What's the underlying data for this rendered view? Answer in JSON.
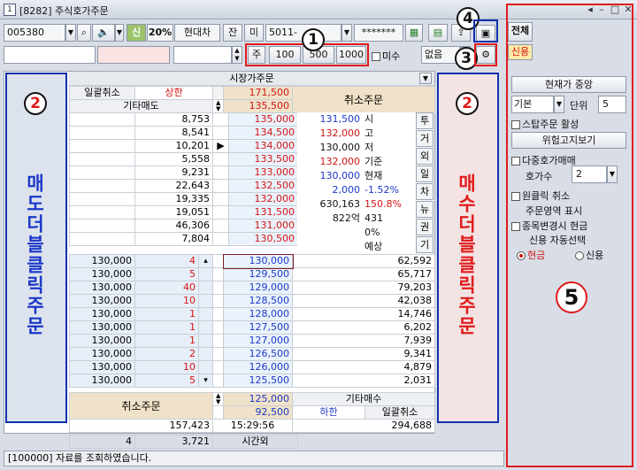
{
  "window": {
    "icon": "1",
    "title": "[8282] 주식호가주문"
  },
  "toolbar": {
    "code": "005380",
    "sin": "신",
    "pct": "20%",
    "stock_name": "현대차",
    "jan": "잔",
    "mi": "미",
    "account": "5011-",
    "password": "*******",
    "btn_all": "전체",
    "btn_credit": "신용"
  },
  "qtybar": {
    "ju": "주",
    "q1": "100",
    "q2": "500",
    "q3": "1000",
    "misu": "미수",
    "none": "없음"
  },
  "header": {
    "market_order": "시장가주문",
    "cancel_all": "일괄취소",
    "upper": "상한",
    "upper_price": "171,500",
    "etc_sell": "기타매도",
    "etc_sell_price": "135,500",
    "cancel_order": "취소주문"
  },
  "ask_rows": [
    {
      "qty": "8,753",
      "price": "135,000"
    },
    {
      "qty": "8,541",
      "price": "134,500"
    },
    {
      "qty": "10,201",
      "price": "134,000"
    },
    {
      "qty": "5,558",
      "price": "133,500"
    },
    {
      "qty": "9,231",
      "price": "133,000"
    },
    {
      "qty": "22,643",
      "price": "132,500"
    },
    {
      "qty": "19,335",
      "price": "132,000"
    },
    {
      "qty": "19,051",
      "price": "131,500"
    },
    {
      "qty": "46,306",
      "price": "131,000"
    },
    {
      "qty": "7,804",
      "price": "130,500"
    }
  ],
  "info_rows": [
    {
      "val": "131,500",
      "label": "시"
    },
    {
      "val": "132,000",
      "label": "고"
    },
    {
      "val": "130,000",
      "label": "저"
    },
    {
      "val": "132,000",
      "label": "기준"
    },
    {
      "val": "130,000",
      "label": "현재"
    },
    {
      "val": "2,000",
      "label": "-1.52%"
    },
    {
      "val": "630,163",
      "label": "150.8%"
    },
    {
      "val": "822억",
      "label": "431"
    },
    {
      "val": "",
      "label": "0%"
    },
    {
      "val": "",
      "label": "예상"
    }
  ],
  "tabs": [
    "투",
    "거",
    "외",
    "일",
    "차",
    "뉴",
    "권",
    "기"
  ],
  "bid_rows": [
    {
      "left": "130,000",
      "cnt": "4",
      "price": "130,000",
      "qty": "62,592"
    },
    {
      "left": "130,000",
      "cnt": "5",
      "price": "129,500",
      "qty": "65,717"
    },
    {
      "left": "130,000",
      "cnt": "40",
      "price": "129,000",
      "qty": "79,203"
    },
    {
      "left": "130,000",
      "cnt": "10",
      "price": "128,500",
      "qty": "42,038"
    },
    {
      "left": "130,000",
      "cnt": "1",
      "price": "128,000",
      "qty": "14,746"
    },
    {
      "left": "130,000",
      "cnt": "1",
      "price": "127,500",
      "qty": "6,202"
    },
    {
      "left": "130,000",
      "cnt": "1",
      "price": "127,000",
      "qty": "7,939"
    },
    {
      "left": "130,000",
      "cnt": "2",
      "price": "126,500",
      "qty": "9,341"
    },
    {
      "left": "130,000",
      "cnt": "10",
      "price": "126,000",
      "qty": "4,879"
    },
    {
      "left": "130,000",
      "cnt": "5",
      "price": "125,500",
      "qty": "2,031"
    }
  ],
  "footer": {
    "cancel_order": "취소주문",
    "price1": "125,000",
    "etc_buy": "기타매수",
    "price2": "92,500",
    "lower": "하한",
    "cancel_all": "일괄취소",
    "total_ask": "157,423",
    "time": "15:29:56",
    "total_bid": "294,688",
    "n1": "4",
    "n2": "3,721",
    "after_hours": "시간외"
  },
  "status": "[100000] 자료를 조회하였습니다.",
  "annotations": {
    "a1": "1",
    "a2": "2",
    "a3": "3",
    "a4": "4",
    "a5": "5",
    "sell_text": "매도더블클릭주문",
    "buy_text": "매수더블클릭주문"
  },
  "right_panel": {
    "btn_center": "현재가 중앙",
    "basic": "기본",
    "unit_label": "단위",
    "unit_val": "5",
    "stop_order": "스탑주문 활성",
    "risk_btn": "위험고지보기",
    "multi_order": "다중호가매매",
    "hoga_label": "호가수",
    "hoga_val": "2",
    "oneclick": "원클릭 취소",
    "order_area": "주문영역 표시",
    "auto_cash": "종목변경시 현금",
    "credit_auto": "신용 자동선택",
    "cash": "현금",
    "credit": "신용"
  },
  "colors": {
    "ask_bg": "#ffffff",
    "bid_bg": "#e6eef8",
    "annot_red": "#e11b1b",
    "annot_blue": "#1030b0",
    "sell_text": "#1c38c9",
    "buy_text": "#e11b1b"
  }
}
